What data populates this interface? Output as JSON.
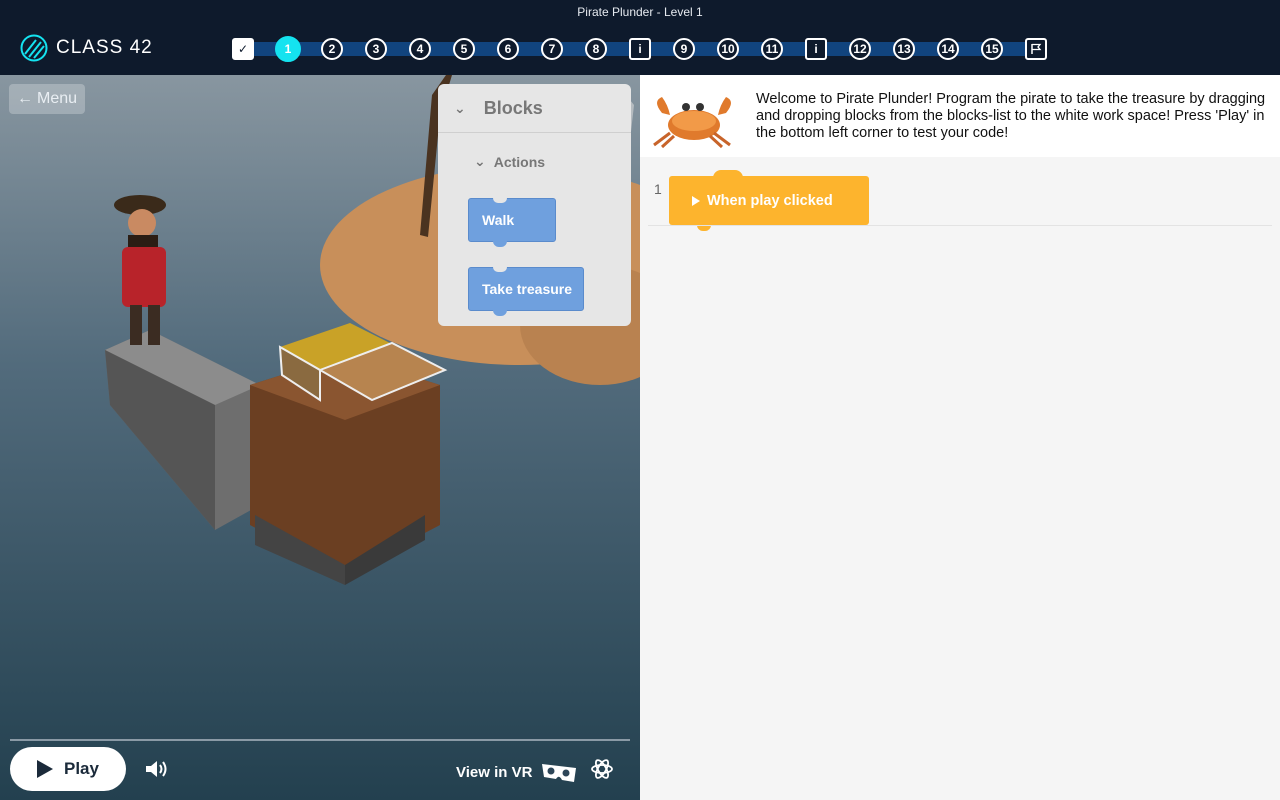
{
  "window": {
    "title": "Pirate Plunder - Level 1"
  },
  "brand": {
    "name": "CLASS 42",
    "accent": "#14e3f0"
  },
  "progress": {
    "steps": [
      {
        "label": "✓",
        "state": "done"
      },
      {
        "label": "1",
        "state": "current"
      },
      {
        "label": "2",
        "state": "todo"
      },
      {
        "label": "3",
        "state": "todo"
      },
      {
        "label": "4",
        "state": "todo"
      },
      {
        "label": "5",
        "state": "todo"
      },
      {
        "label": "6",
        "state": "todo"
      },
      {
        "label": "7",
        "state": "todo"
      },
      {
        "label": "8",
        "state": "todo"
      },
      {
        "label": "i",
        "state": "info"
      },
      {
        "label": "9",
        "state": "todo"
      },
      {
        "label": "10",
        "state": "todo"
      },
      {
        "label": "11",
        "state": "todo"
      },
      {
        "label": "i",
        "state": "info"
      },
      {
        "label": "12",
        "state": "todo"
      },
      {
        "label": "13",
        "state": "todo"
      },
      {
        "label": "14",
        "state": "todo"
      },
      {
        "label": "15",
        "state": "todo"
      },
      {
        "label": "",
        "icon": "flag-icon",
        "state": "finish"
      }
    ]
  },
  "scene": {
    "menu_label": "Menu",
    "blocks_panel": {
      "title": "Blocks",
      "category": "Actions",
      "blocks": [
        "Walk",
        "Take treasure"
      ]
    },
    "controls": {
      "play_label": "Play",
      "vr_label": "View in VR"
    }
  },
  "instructions": {
    "text": "Welcome to Pirate Plunder! Program the pirate to take the treasure by dragging and dropping blocks from the blocks-list to the white work space! Press 'Play' in the bottom left corner to test your code!"
  },
  "workspace": {
    "line_number": "1",
    "event_block_label": "When play clicked"
  },
  "colors": {
    "header_bg": "#0e1a2c",
    "track": "#11447e",
    "action_block": "#6fa0de",
    "event_block": "#fdb42d"
  }
}
